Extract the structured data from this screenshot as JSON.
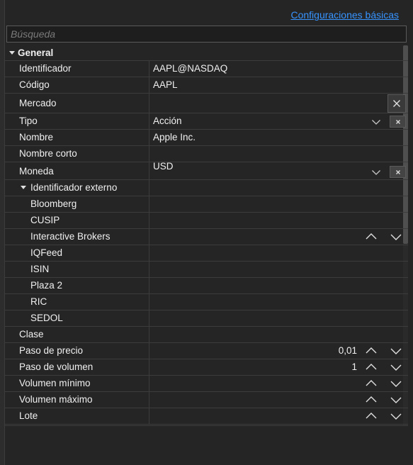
{
  "header": {
    "basic_settings_link": "Configuraciones básicas"
  },
  "search": {
    "placeholder": "Búsqueda",
    "value": ""
  },
  "category": {
    "label": "General"
  },
  "rows": {
    "identificador": {
      "label": "Identificador",
      "value": "AAPL@NASDAQ"
    },
    "codigo": {
      "label": "Código",
      "value": "AAPL"
    },
    "mercado": {
      "label": "Mercado",
      "value": ""
    },
    "tipo": {
      "label": "Tipo",
      "value": "Acción"
    },
    "nombre": {
      "label": "Nombre",
      "value": "Apple Inc."
    },
    "nombre_corto": {
      "label": "Nombre corto",
      "value": ""
    },
    "moneda": {
      "label": "Moneda",
      "value": "USD"
    },
    "ext_id": {
      "label": "Identificador externo"
    },
    "bloomberg": {
      "label": "Bloomberg"
    },
    "cusip": {
      "label": "CUSIP"
    },
    "ib": {
      "label": "Interactive Brokers"
    },
    "iqfeed": {
      "label": "IQFeed"
    },
    "isin": {
      "label": "ISIN"
    },
    "plaza2": {
      "label": "Plaza 2"
    },
    "ric": {
      "label": "RIC"
    },
    "sedol": {
      "label": "SEDOL"
    },
    "clase": {
      "label": "Clase"
    },
    "paso_precio": {
      "label": "Paso de precio",
      "value": "0,01"
    },
    "paso_volumen": {
      "label": "Paso de volumen",
      "value": "1"
    },
    "vol_min": {
      "label": "Volumen mínimo",
      "value": ""
    },
    "vol_max": {
      "label": "Volumen máximo",
      "value": ""
    },
    "lote": {
      "label": "Lote",
      "value": ""
    }
  },
  "icons": {
    "expand": "caret-down-icon",
    "clear": "close-icon",
    "dropdown": "chevron-down-icon",
    "increment": "chevron-up-icon",
    "decrement": "chevron-down-icon"
  },
  "colors": {
    "link": "#3794ff",
    "background": "#252526",
    "grid_line": "#3c3c3c"
  }
}
